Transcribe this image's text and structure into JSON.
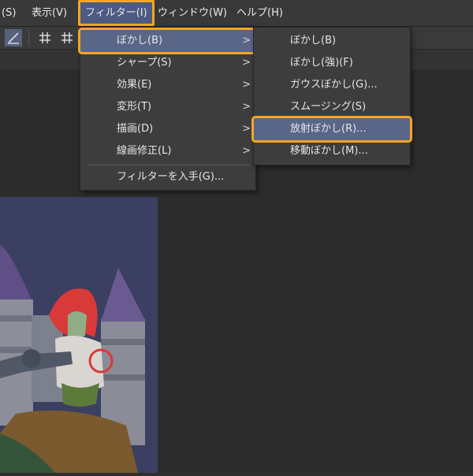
{
  "menubar": {
    "items": [
      {
        "label": "(S)"
      },
      {
        "label": "表示(V)"
      },
      {
        "label": "フィルター(I)"
      },
      {
        "label": "ウィンドウ(W)"
      },
      {
        "label": "ヘルプ(H)"
      }
    ]
  },
  "toolbar": {
    "icons": [
      "pen-ruler-icon",
      "grid-icon",
      "grid-icon"
    ]
  },
  "filter_menu": {
    "items": [
      {
        "label": "ぼかし(B)",
        "arrow": ">"
      },
      {
        "label": "シャープ(S)",
        "arrow": ">"
      },
      {
        "label": "効果(E)",
        "arrow": ">"
      },
      {
        "label": "変形(T)",
        "arrow": ">"
      },
      {
        "label": "描画(D)",
        "arrow": ">"
      },
      {
        "label": "線画修正(L)",
        "arrow": ">"
      },
      {
        "label": "フィルターを入手(G)..."
      }
    ]
  },
  "blur_submenu": {
    "items": [
      {
        "label": "ぼかし(B)"
      },
      {
        "label": "ぼかし(強)(F)"
      },
      {
        "label": "ガウスぼかし(G)..."
      },
      {
        "label": "スムージング(S)"
      },
      {
        "label": "放射ぼかし(R)..."
      },
      {
        "label": "移動ぼかし(M)..."
      }
    ]
  },
  "colors": {
    "highlight_outline": "#f5a623",
    "selected_bg": "#5a6688",
    "menu_bg": "#3d3d3d",
    "canvas_bg": "#3b3f61"
  }
}
